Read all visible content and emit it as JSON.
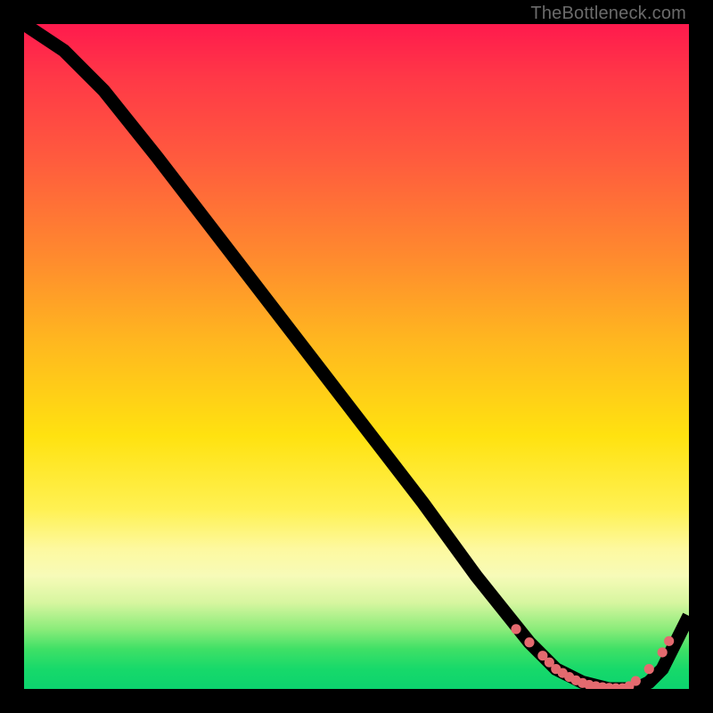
{
  "attribution": "TheBottleneck.com",
  "colors": {
    "marker": "#e46a6f",
    "curve": "#000000",
    "frame": "#000000"
  },
  "chart_data": {
    "type": "line",
    "title": "",
    "xlabel": "",
    "ylabel": "",
    "xlim": [
      0,
      100
    ],
    "ylim": [
      0,
      100
    ],
    "note": "Axes are implicit (0–100 %). Curve y is bottleneck % (high = red/top).",
    "curve": {
      "x": [
        0,
        6,
        12,
        20,
        30,
        40,
        50,
        60,
        68,
        72,
        76,
        80,
        84,
        88,
        92,
        94,
        96,
        100
      ],
      "y": [
        100,
        96,
        90,
        80,
        67,
        54,
        41,
        28,
        17,
        12,
        7,
        3,
        1,
        0,
        0,
        1,
        3,
        11
      ]
    },
    "markers": {
      "comment": "pink dots along the valley floor",
      "x": [
        74,
        76,
        78,
        79,
        80,
        81,
        82,
        83,
        84,
        85,
        86,
        87,
        88,
        89,
        90,
        91,
        92,
        94,
        96,
        97
      ],
      "y": [
        9,
        7,
        5,
        4,
        3,
        2.4,
        1.8,
        1.3,
        0.9,
        0.6,
        0.4,
        0.25,
        0.15,
        0.1,
        0.1,
        0.4,
        1.2,
        3.0,
        5.5,
        7.2
      ]
    }
  }
}
